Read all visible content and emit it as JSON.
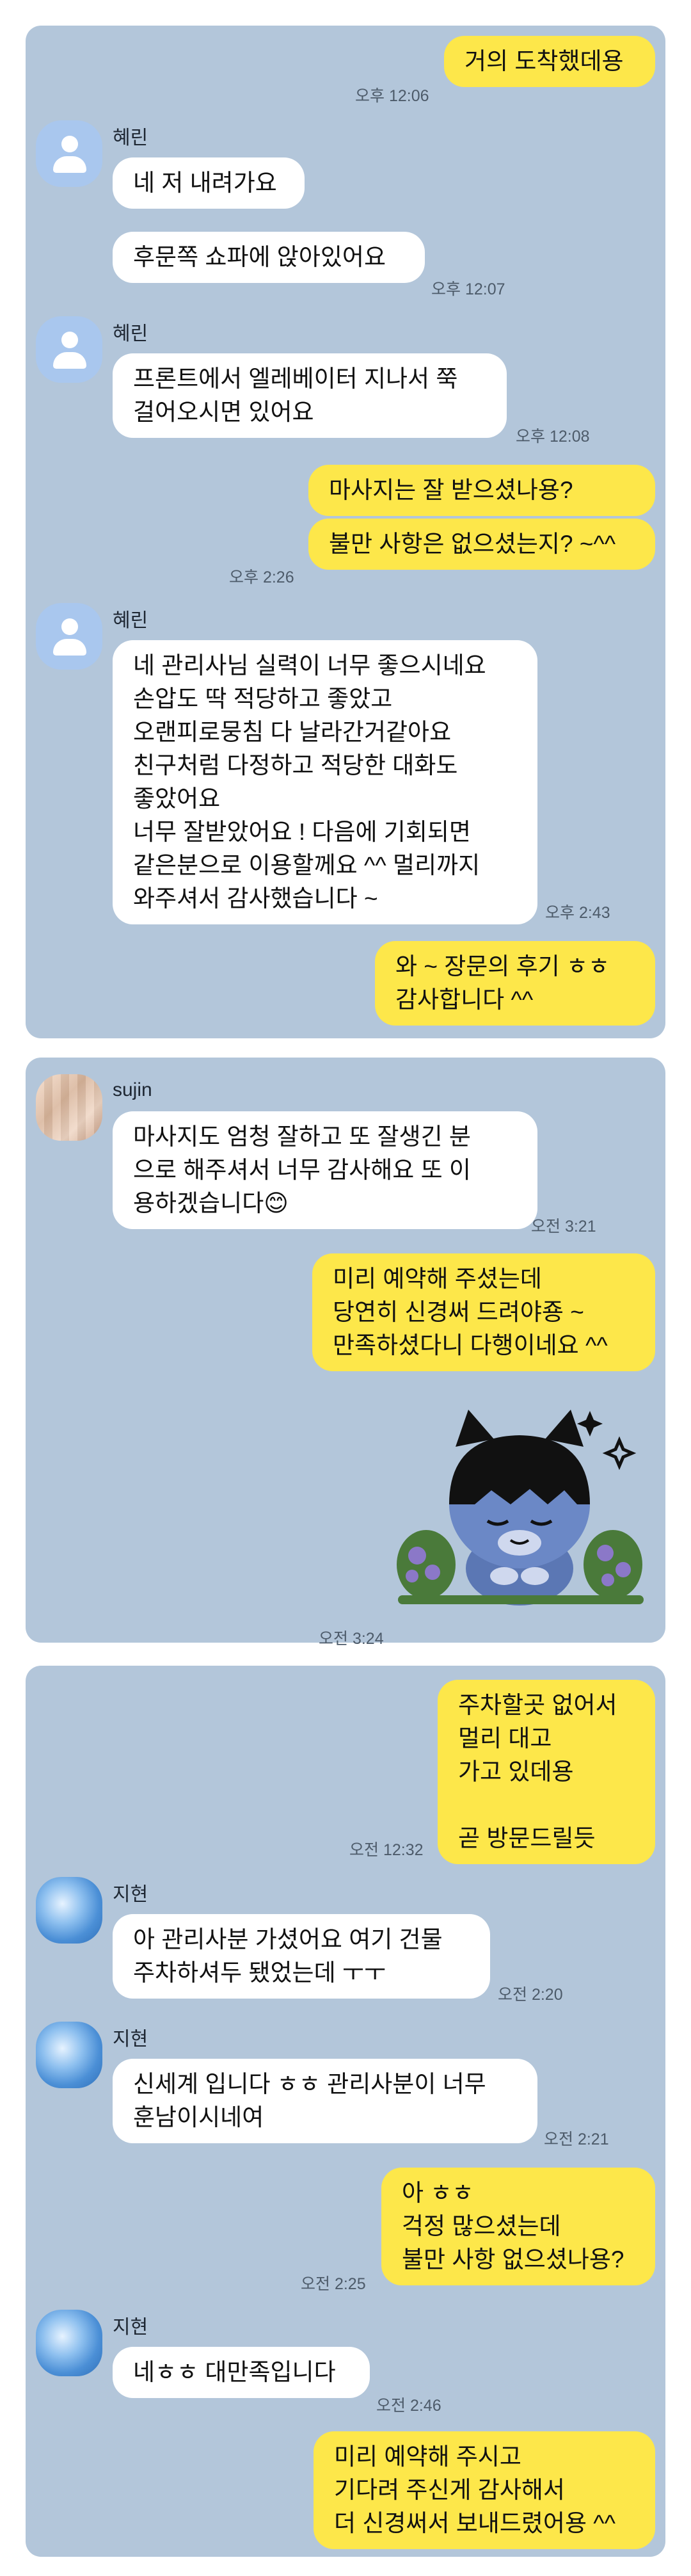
{
  "panel1": {
    "messages": [
      {
        "text": "거의 도착했데용",
        "time": "오후 12:06"
      },
      {
        "sender": "혜린",
        "text": "네 저 내려가요"
      },
      {
        "text": "후문쪽 쇼파에 앉아있어요",
        "time": "오후 12:07"
      },
      {
        "sender": "혜린",
        "text": "프론트에서 엘레베이터 지나서 쭉\n걸어오시면 있어요",
        "time": "오후 12:08"
      },
      {
        "text": "마사지는 잘 받으셨나용?"
      },
      {
        "text": "불만 사항은 없으셨는지? ~^^",
        "time": "오후 2:26"
      },
      {
        "sender": "혜린",
        "text": "네 관리사님 실력이 너무 좋으시네요\n손압도 딱 적당하고 좋았고\n오랜피로뭉침 다 날라간거같아요\n친구처럼 다정하고 적당한 대화도\n좋았어요\n너무 잘받았어요 ! 다음에 기회되면\n같은분으로 이용할께요 ^^ 멀리까지\n와주셔서 감사했습니다 ~",
        "time": "오후 2:43"
      },
      {
        "text": "와 ~ 장문의 후기 ㅎㅎ\n감사합니다 ^^"
      }
    ]
  },
  "panel2": {
    "messages": [
      {
        "sender": "sujin",
        "text": "마사지도 엄청 잘하고 또 잘생긴 분\n으로 해주셔서 너무 감사해요 또 이\n용하겠습니다😊",
        "time": "오전 3:21"
      },
      {
        "text": "미리 예약해 주셨는데\n당연히 신경써 드려야죵 ~\n만족하셨다니 다행이네요 ^^"
      },
      {
        "sticker": "kakao-character-sticker",
        "time": "오전 3:24"
      }
    ]
  },
  "panel3": {
    "messages": [
      {
        "text": "주차할곳 없어서\n멀리 대고\n가고 있데용\n\n곧 방문드릴듯",
        "time": "오전 12:32"
      },
      {
        "sender": "지현",
        "text": "아 관리사분 가셨어요 여기 건물\n주차하셔두 됐었는데 ㅜㅜ",
        "time": "오전 2:20"
      },
      {
        "sender": "지현",
        "text": "신세계 입니다 ㅎㅎ 관리사분이 너무\n훈남이시네여",
        "time": "오전 2:21"
      },
      {
        "text": "아 ㅎㅎ\n걱정 많으셨는데\n불만 사항 없으셨나용?",
        "time": "오전 2:25"
      },
      {
        "sender": "지현",
        "text": "네ㅎㅎ 대만족입니다",
        "time": "오전 2:46"
      },
      {
        "text": "미리 예약해 주시고\n기다려 주신게 감사해서\n더 신경써서 보내드렸어용 ^^"
      }
    ]
  },
  "colors": {
    "my_bubble": "#fde74a",
    "their_bubble": "#ffffff",
    "chat_background": "#b3c6da"
  }
}
